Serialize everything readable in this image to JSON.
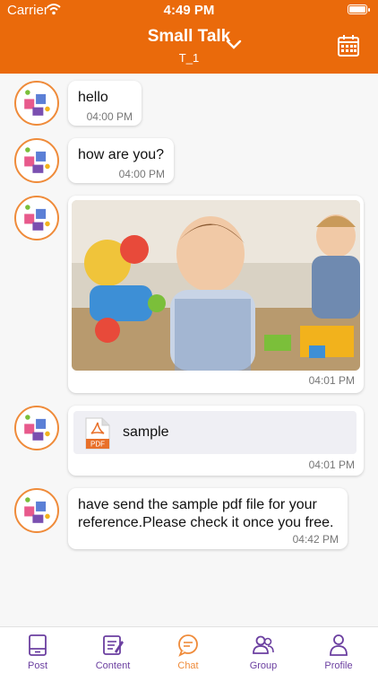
{
  "status_bar": {
    "carrier": "Carrier",
    "time": "4:49 PM"
  },
  "header": {
    "title": "Small Talk",
    "subtitle": "T_1"
  },
  "messages": [
    {
      "text": "hello",
      "time": "04:00 PM"
    },
    {
      "text": "how are you?",
      "time": "04:00 PM"
    },
    {
      "type": "image",
      "time": "04:01 PM"
    },
    {
      "type": "file",
      "file_name": "sample",
      "file_type": "PDF",
      "time": "04:01 PM"
    },
    {
      "text": "have send the sample pdf file for your reference.Please check it once you free.",
      "time": "04:42 PM"
    }
  ],
  "tabs": [
    {
      "label": "Post",
      "icon": "post-icon"
    },
    {
      "label": "Content",
      "icon": "content-icon"
    },
    {
      "label": "Chat",
      "icon": "chat-icon",
      "active": true
    },
    {
      "label": "Group",
      "icon": "group-icon"
    },
    {
      "label": "Profile",
      "icon": "profile-icon"
    }
  ],
  "colors": {
    "accent": "#ea6a0b",
    "tab_inactive": "#6b3fa0",
    "tab_active": "#ef8b3a"
  }
}
